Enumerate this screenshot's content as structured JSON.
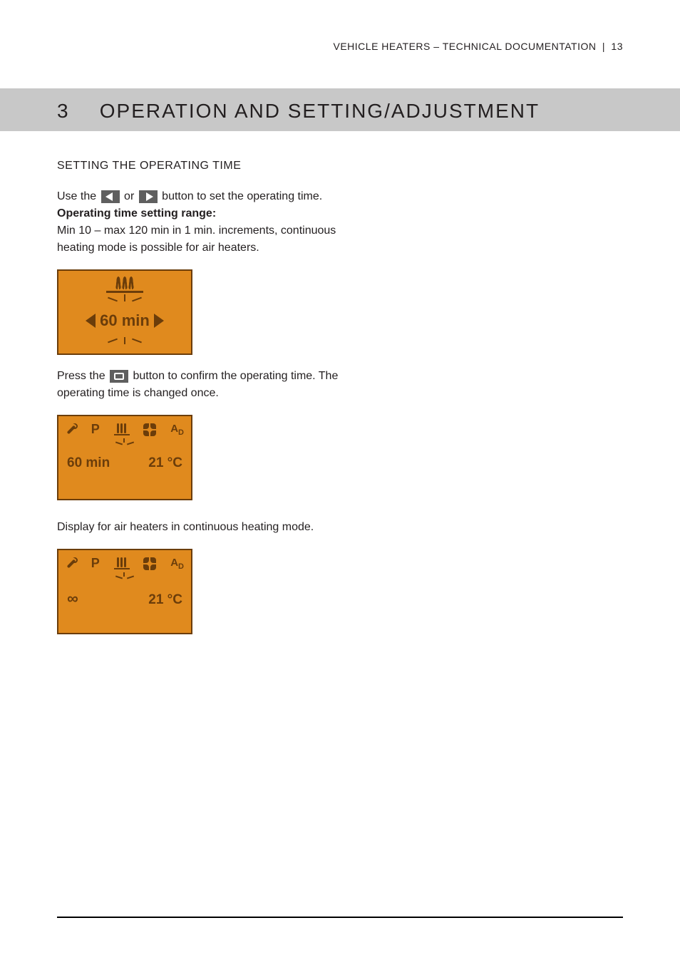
{
  "header": {
    "left": "VEHICLE HEATERS – TECHNICAL DOCUMENTATION",
    "page": "13"
  },
  "section": {
    "number": "3",
    "title": "OPERATION AND SETTING/ADJUSTMENT"
  },
  "subhead": "SETTING THE OPERATING TIME",
  "para1_a": "Use the ",
  "para1_b": " or ",
  "para1_c": " button to set the operating time.",
  "range_label": "Operating time setting range:",
  "range_text": "Min 10 – max 120 min in 1 min. increments, continuous heating mode is possible for air heaters.",
  "display1": {
    "time": "60 min"
  },
  "para2_a": "Press the ",
  "para2_b": " button to confirm the operating time. The operating time is changed once.",
  "display2": {
    "p": "P",
    "ad": "A",
    "ad_sub": "D",
    "time": "60 min",
    "temp": "21 °C"
  },
  "caption2": "Display for air heaters in continuous heating mode.",
  "display3": {
    "p": "P",
    "ad": "A",
    "ad_sub": "D",
    "inf": "∞",
    "temp": "21 °C"
  }
}
